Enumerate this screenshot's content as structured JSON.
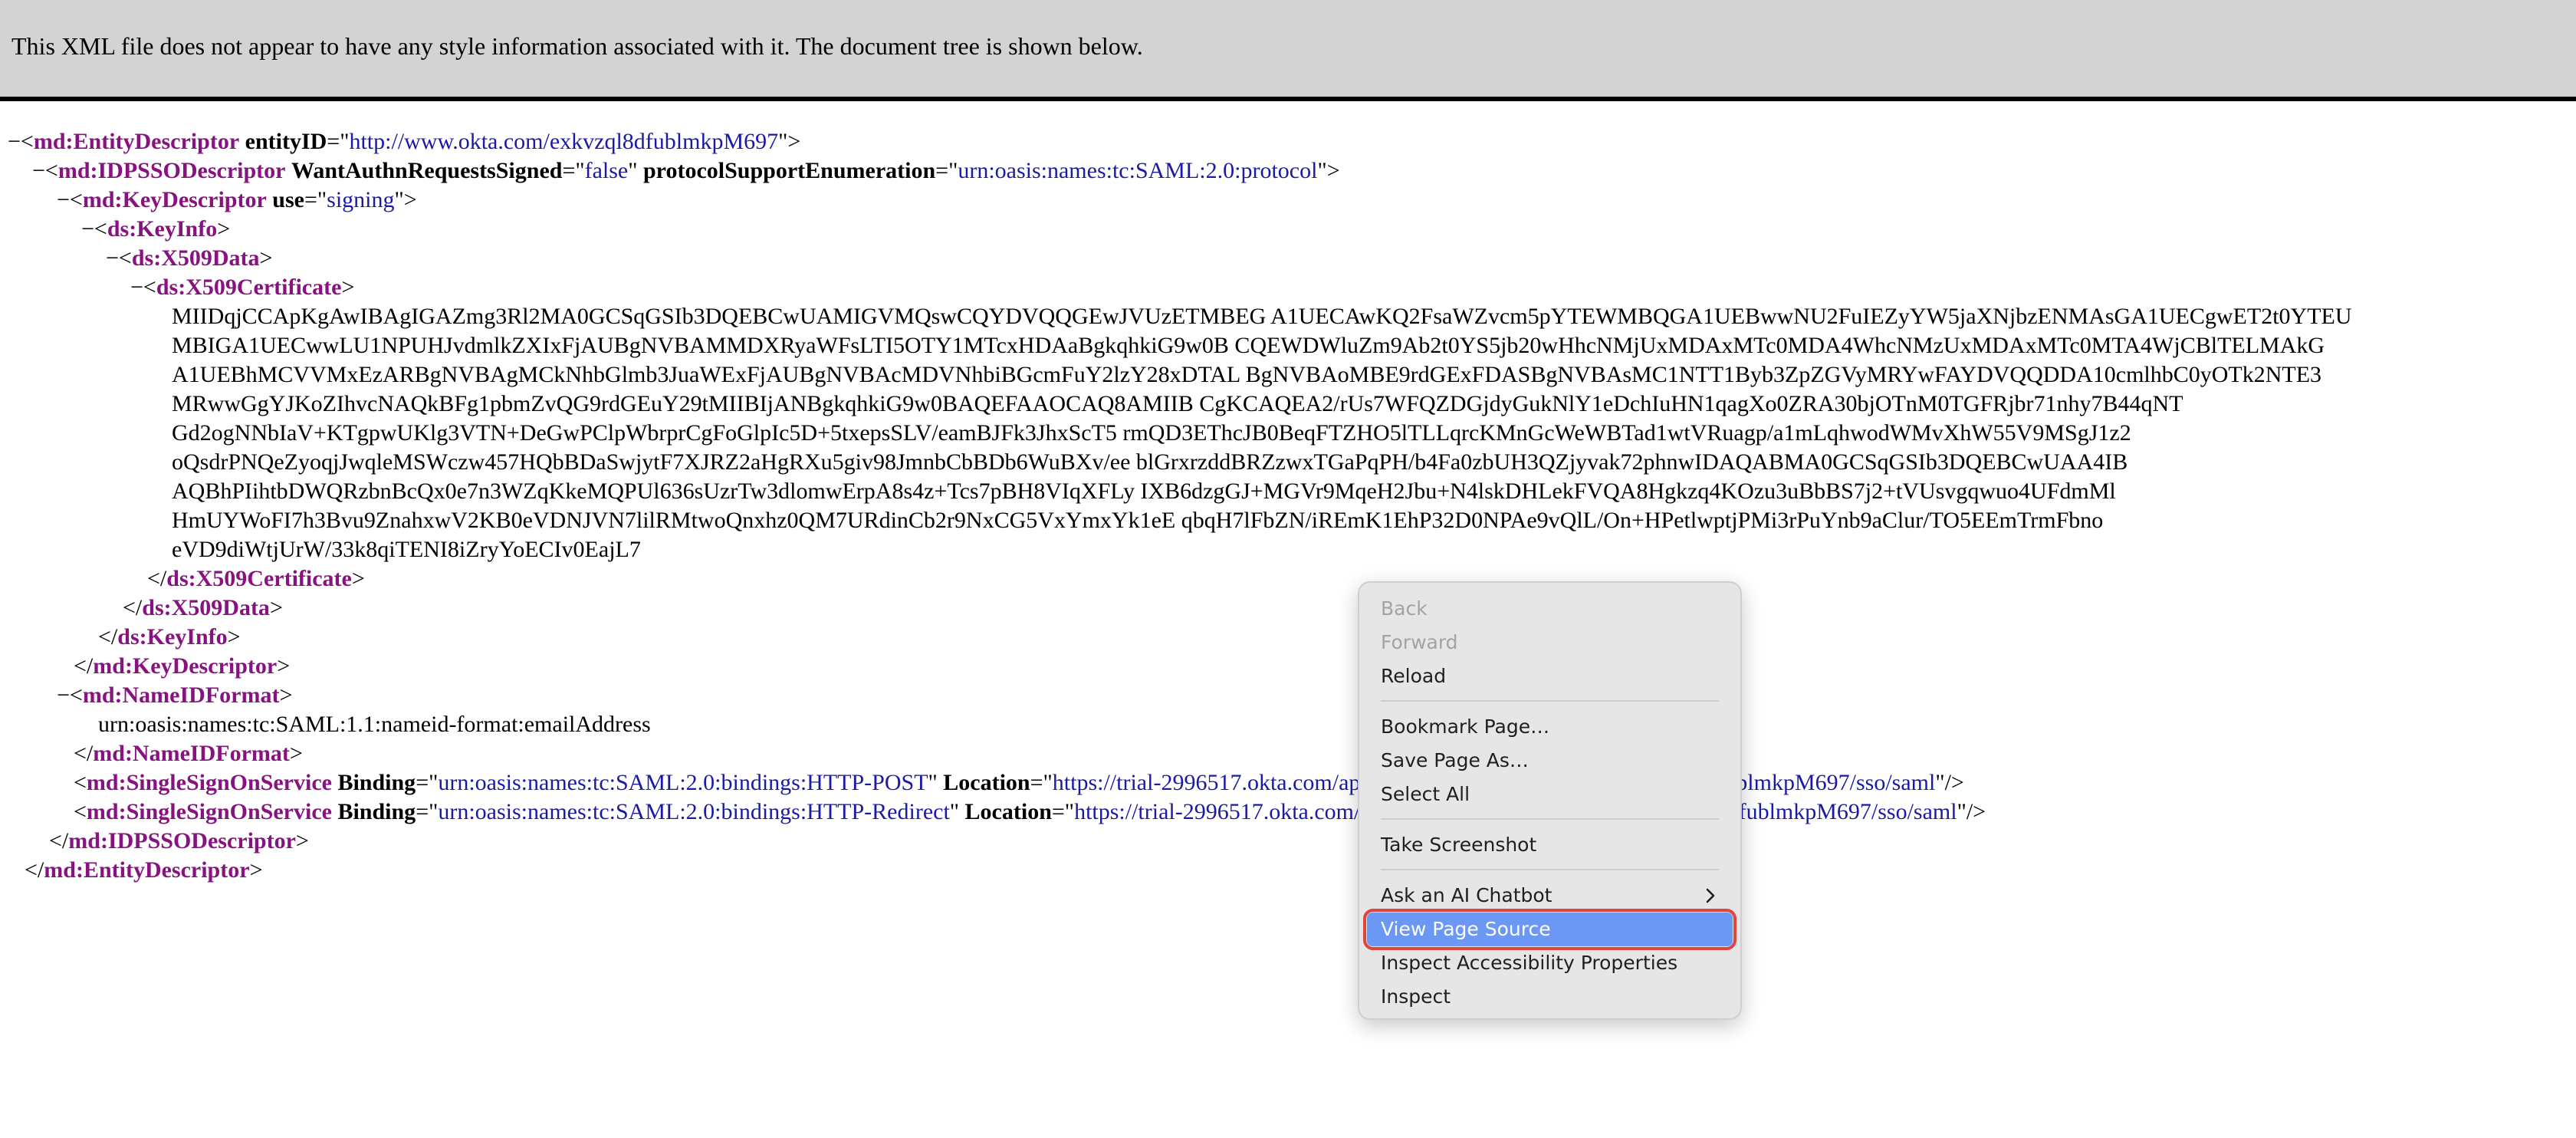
{
  "banner": {
    "text": "This XML file does not appear to have any style information associated with it. The document tree is shown below."
  },
  "xml": {
    "fold_symbol": "−",
    "entity_open": {
      "tag": "md:EntityDescriptor",
      "attr": "entityID",
      "value": "http://www.okta.com/exkvzql8dfublmkpM697"
    },
    "idpsso_open": {
      "tag": "md:IDPSSODescriptor",
      "attr1": "WantAuthnRequestsSigned",
      "value1": "false",
      "attr2": "protocolSupportEnumeration",
      "value2": "urn:oasis:names:tc:SAML:2.0:protocol"
    },
    "keydesc_open": {
      "tag": "md:KeyDescriptor",
      "attr": "use",
      "value": "signing"
    },
    "keyinfo_tag": "ds:KeyInfo",
    "x509data_tag": "ds:X509Data",
    "x509cert_tag": "ds:X509Certificate",
    "cert_lines": [
      "MIIDqjCCApKgAwIBAgIGAZmg3Rl2MA0GCSqGSIb3DQEBCwUAMIGVMQswCQYDVQQGEwJVUzETMBEG A1UECAwKQ2FsaWZvcm5pYTEWMBQGA1UEBwwNU2FuIEZyYW5jaXNjbzENMAsGA1UECgwET2t0YTEU",
      "MBIGA1UECwwLU1NPUHJvdmlkZXIxFjAUBgNVBAMMDXRyaWFsLTI5OTY1MTcxHDAaBgkqhkiG9w0B CQEWDWluZm9Ab2t0YS5jb20wHhcNMjUxMDAxMTc0MDA4WhcNMzUxMDAxMTc0MTA4WjCBlTELMAkG",
      "A1UEBhMCVVMxEzARBgNVBAgMCkNhbGlmb3JuaWExFjAUBgNVBAcMDVNhbiBGcmFuY2lzY28xDTAL BgNVBAoMBE9rdGExFDASBgNVBAsMC1NTT1Byb3ZpZGVyMRYwFAYDVQQDDA10cmlhbC0yOTk2NTE3",
      "MRwwGgYJKoZIhvcNAQkBFg1pbmZvQG9rdGEuY29tMIIBIjANBgkqhkiG9w0BAQEFAAOCAQ8AMIIB CgKCAQEA2/rUs7WFQZDGjdyGukNlY1eDchIuHN1qagXo0ZRA30bjOTnM0TGFRjbr71nhy7B44qNT",
      "Gd2ogNNbIaV+KTgpwUKlg3VTN+DeGwPClpWbrprCgFoGlpIc5D+5txepsSLV/eamBJFk3JhxScT5 rmQD3EThcJB0BeqFTZHO5lTLLqrcKMnGcWeWBTad1wtVRuagp/a1mLqhwodWMvXhW55V9MSgJ1z2",
      "oQsdrPNQeZyoqjJwqleMSWczw457HQbBDaSwjytF7XJRZ2aHgRXu5giv98JmnbCbBDb6WuBXv/ee blGrxrzddBRZzwxTGaPqPH/b4Fa0zbUH3QZjyvak72phnwIDAQABMA0GCSqGSIb3DQEBCwUAA4IB",
      "AQBhPIihtbDWQRzbnBcQx0e7n3WZqKkeMQPUl636sUzrTw3dlomwErpA8s4z+Tcs7pBH8VIqXFLy IXB6dzgGJ+MGVr9MqeH2Jbu+N4lskDHLekFVQA8Hgkzq4KOzu3uBbBS7j2+tVUsvgqwuo4UFdmMl",
      "HmUYWoFI7h3Bvu9ZnahxwV2KB0eVDNJVN7lilRMtwoQnxhz0QM7URdinCb2r9NxCG5VxYmxYk1eE qbqH7lFbZN/iREmK1EhP32D0NPAe9vQlL/On+HPetlwptjPMi3rPuYnb9aClur/TO5EEmTrmFbno",
      "eVD9diWtjUrW/33k8qiTENI8iZryYoECIv0EajL7"
    ],
    "nameid_tag": "md:NameIDFormat",
    "nameid_value": "urn:oasis:names:tc:SAML:1.1:nameid-format:emailAddress",
    "sso_tag": "md:SingleSignOnService",
    "sso_post": {
      "attr1": "Binding",
      "value1": "urn:oasis:names:tc:SAML:2.0:bindings:HTTP-POST",
      "attr2": "Location",
      "value2": "https://trial-2996517.okta.com/app/trial-2996517_samlapp_1/exkvzql8dfublmkpM697/sso/saml"
    },
    "sso_redirect": {
      "attr1": "Binding",
      "value1": "urn:oasis:names:tc:SAML:2.0:bindings:HTTP-Redirect",
      "attr2": "Location",
      "value2": "https://trial-2996517.okta.com/app/trial-2996517_samlapp_1/exkvzql8dfublmkpM697/sso/saml"
    }
  },
  "context_menu": {
    "back": "Back",
    "forward": "Forward",
    "reload": "Reload",
    "bookmark": "Bookmark Page…",
    "save_as": "Save Page As…",
    "select_all": "Select All",
    "screenshot": "Take Screenshot",
    "ai_chatbot": "Ask an AI Chatbot",
    "view_source": "View Page Source",
    "inspect_accessibility": "Inspect Accessibility Properties",
    "inspect": "Inspect",
    "highlight_color": "#6b98f5",
    "ring_color": "#e0443e"
  }
}
